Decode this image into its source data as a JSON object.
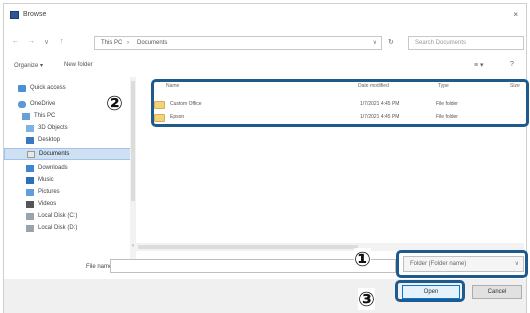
{
  "titlebar": {
    "title": "Browse",
    "close": "×"
  },
  "addressbar": {
    "back": "←",
    "forward": "→",
    "up_history": "∨",
    "up": "↑",
    "crumbs": [
      "This PC",
      "›",
      "Documents"
    ],
    "dropdown": "∨",
    "refresh": "↻",
    "search_placeholder": "Search Documents"
  },
  "toolbar": {
    "organize": "Organize ▾",
    "new_folder": "New folder",
    "view": "≡ ▾",
    "help": "?"
  },
  "sidebar": {
    "items": [
      {
        "label": "Quick access"
      },
      {
        "label": "OneDrive"
      },
      {
        "label": "This PC"
      },
      {
        "label": "3D Objects"
      },
      {
        "label": "Desktop"
      },
      {
        "label": "Documents"
      },
      {
        "label": "Downloads"
      },
      {
        "label": "Music"
      },
      {
        "label": "Pictures"
      },
      {
        "label": "Videos"
      },
      {
        "label": "Local Disk (C:)"
      },
      {
        "label": "Local Disk (D:)"
      }
    ]
  },
  "filelist": {
    "headers": [
      "Name",
      "Date modified",
      "Type",
      "Size"
    ],
    "rows": [
      {
        "name": "Custom Office",
        "date": "1/7/2021 4:45 PM",
        "type": "File folder"
      },
      {
        "name": "Epson",
        "date": "1/7/2021 4:45 PM",
        "type": "File folder"
      }
    ]
  },
  "footer": {
    "filename_label": "File name:",
    "filename_value": "",
    "filetype_value": "Folder (Folder name)",
    "open_label": "Open",
    "cancel_label": "Cancel"
  },
  "callouts": {
    "one": "①",
    "two": "②",
    "three": "③"
  },
  "colors": {
    "callout": "#1f5a8c",
    "selection": "#cfe0f3",
    "folder": "#f2d27a"
  }
}
